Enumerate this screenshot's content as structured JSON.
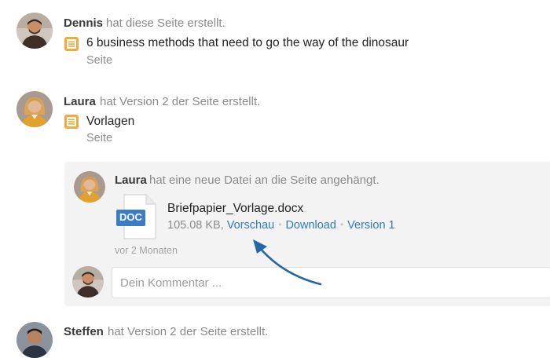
{
  "feed": [
    {
      "author": "Dennis",
      "action": "hat diese Seite erstellt.",
      "title": "6 business methods that need to go the way of the dinosaur",
      "type": "Seite",
      "icon": "page-icon"
    },
    {
      "author": "Laura",
      "action": "hat Version 2 der Seite erstellt.",
      "title": "Vorlagen",
      "type": "Seite",
      "icon": "page-icon"
    }
  ],
  "attachment": {
    "author": "Laura",
    "action": "hat eine neue Datei an die Seite angehängt.",
    "file_badge": "DOC",
    "file_name": "Briefpapier_Vorlage.docx",
    "file_size": "105.08 KB,",
    "preview_label": "Vorschau",
    "download_label": "Download",
    "version_label": "Version 1",
    "time": "vor 2 Monaten",
    "comment_placeholder": "Dein Kommentar ..."
  },
  "last_entry": {
    "author": "Steffen",
    "action": "hat Version 2 der Seite erstellt."
  },
  "colors": {
    "link": "#2f7ac4",
    "page_icon": "#f0a93b",
    "doc_badge": "#3b7cc4",
    "arrow": "#2466a6"
  }
}
